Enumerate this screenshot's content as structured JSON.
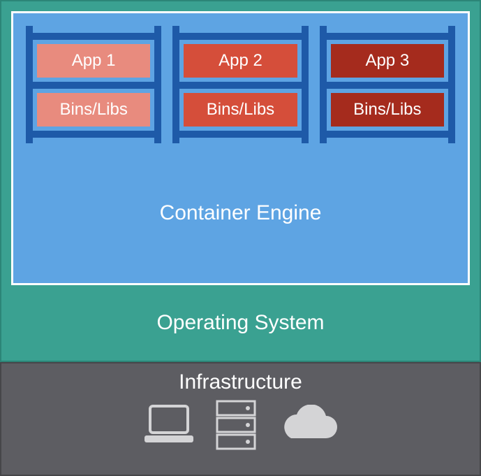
{
  "engine": {
    "label": "Container Engine",
    "containers": [
      {
        "app": "App 1",
        "libs": "Bins/Libs",
        "color": "salmon"
      },
      {
        "app": "App 2",
        "libs": "Bins/Libs",
        "color": "red"
      },
      {
        "app": "App 3",
        "libs": "Bins/Libs",
        "color": "darkred"
      }
    ]
  },
  "os": {
    "label": "Operating System"
  },
  "infra": {
    "label": "Infrastructure",
    "icons": [
      "laptop",
      "server",
      "cloud"
    ]
  },
  "colors": {
    "teal": "#3aa191",
    "blue": "#5ea4e3",
    "darkblue": "#1e5aa8",
    "grey": "#5d5d62",
    "salmon": "#e88b7e",
    "red": "#d54e3a",
    "darkred": "#a52b1d"
  }
}
